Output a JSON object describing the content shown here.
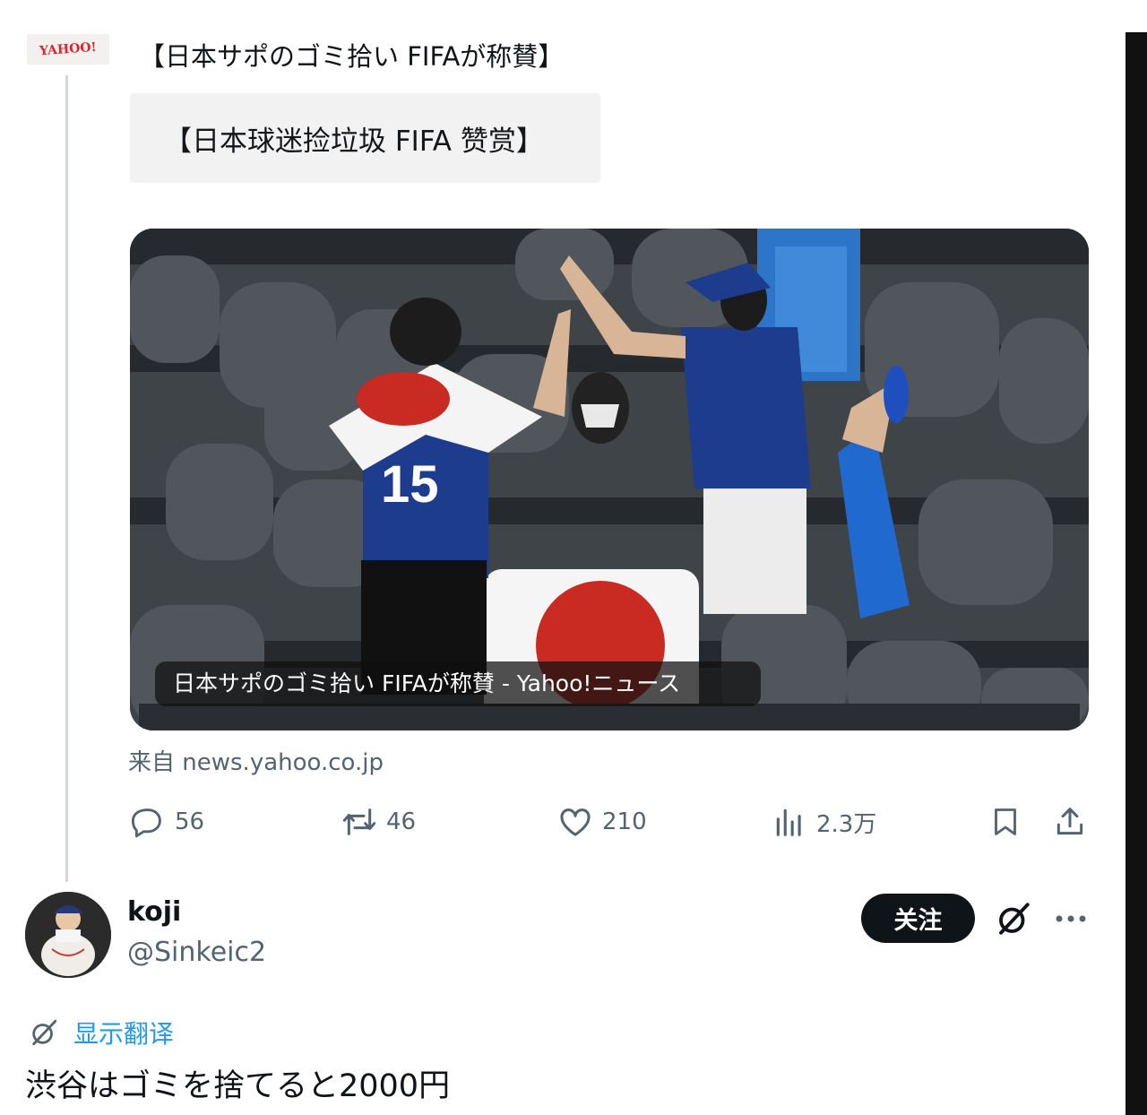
{
  "quoted_post": {
    "source_logo_text": "YAHOO!",
    "title": "【日本サポのゴミ拾い FIFAが称賛】",
    "quote_text": "【日本球迷捡垃圾 FIFA 赞赏】",
    "media_caption": "日本サポのゴミ拾い FIFAが称賛 - Yahoo!ニュース",
    "source_link": "来自 news.yahoo.co.jp",
    "actions": {
      "replies": "56",
      "reposts": "46",
      "likes": "210",
      "views": "2.3万"
    }
  },
  "reply": {
    "display_name": "koji",
    "handle": "@Sinkeic2",
    "follow_label": "关注",
    "translate_label": "显示翻译",
    "text": "渋谷はゴミを捨てると2000円"
  },
  "colors": {
    "accent_blue": "#1d9bf0",
    "text_primary": "#0f1419",
    "text_secondary": "#536471",
    "yahoo_red": "#d7282f"
  },
  "icons": [
    "reply-icon",
    "repost-icon",
    "like-icon",
    "views-icon",
    "bookmark-icon",
    "share-icon",
    "grok-icon",
    "more-icon",
    "translate-icon"
  ]
}
